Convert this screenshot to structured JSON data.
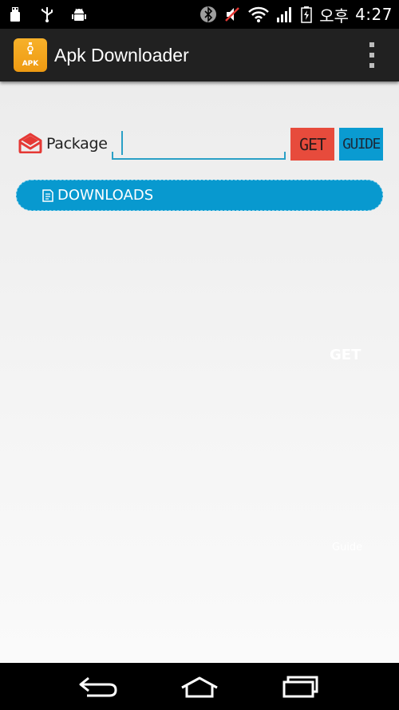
{
  "status_bar": {
    "lang": "오후",
    "time": "4:27",
    "icons_left": [
      "usb-icon",
      "usb-trident-icon",
      "android-debug-icon"
    ],
    "icons_right": [
      "bluetooth-icon",
      "mute-icon",
      "wifi-icon",
      "signal-icon",
      "battery-charging-icon"
    ]
  },
  "action_bar": {
    "app_icon_text": "APK",
    "title": "Apk Downloader",
    "overflow_icon": "overflow-menu-icon"
  },
  "form": {
    "package_label": "Package",
    "package_value": "",
    "get_label": "GET",
    "guide_label": "GUIDE",
    "downloads_label": "DOWNLOADS"
  },
  "background_text": {
    "get": "GET",
    "guide": "Guide"
  },
  "colors": {
    "get_button": "#e74b3c",
    "guide_button": "#0a9bd1",
    "downloads_button": "#0899cf",
    "input_underline": "#2aa0c6",
    "app_icon": "#f7b12a",
    "action_bar": "#212121"
  },
  "nav_bar": {
    "icons": [
      "back-icon",
      "home-icon",
      "recent-apps-icon"
    ]
  }
}
